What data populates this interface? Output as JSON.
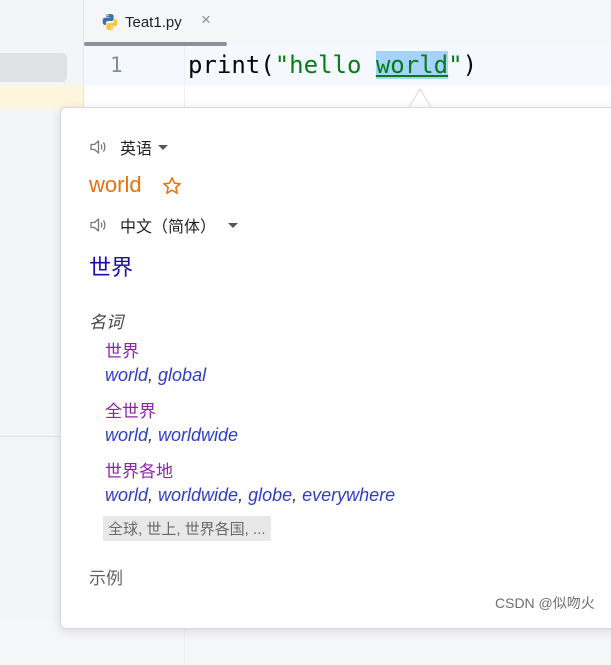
{
  "tab": {
    "filename": "Teat1.py",
    "close_glyph": "×"
  },
  "editor": {
    "line_number": "1",
    "code": {
      "func": "print",
      "open": "(",
      "string_prefix": "\"hello ",
      "selected_word": "world",
      "string_suffix": "\"",
      "close": ")"
    }
  },
  "popup": {
    "source_lang": "英语",
    "source_word": "world",
    "target_lang": "中文（简体）",
    "target_word": "世界",
    "part_of_speech": "名词",
    "entries": [
      {
        "term": "世界",
        "synonyms": [
          "world",
          "global"
        ]
      },
      {
        "term": "全世界",
        "synonyms": [
          "world",
          "worldwide"
        ]
      },
      {
        "term": "世界各地",
        "synonyms": [
          "world",
          "worldwide",
          "globe",
          "everywhere"
        ]
      }
    ],
    "more": "全球, 世上, 世界各国, ...",
    "examples_label": "示例"
  },
  "watermark": "CSDN @似吻火",
  "icons": {
    "file_type": "python-icon",
    "speaker": "speaker-icon",
    "star": "star-outline-icon",
    "caret": "caret-down-icon"
  },
  "colors": {
    "source_word": "#e8710a",
    "target_word": "#1a0dab",
    "entry_term": "#8e24aa",
    "synonym": "#2d3ec5",
    "string_literal": "#067d17",
    "selection": "#a6d2ff"
  }
}
